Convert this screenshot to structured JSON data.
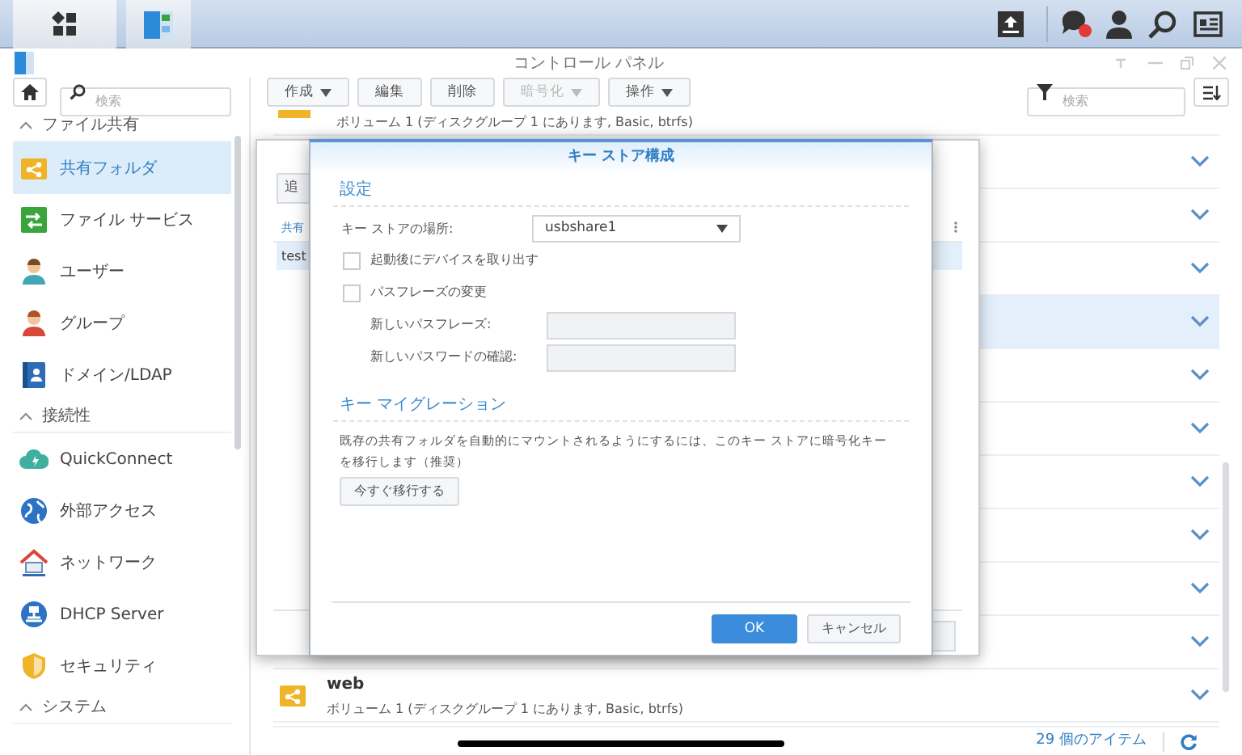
{
  "window": {
    "title": "コントロール パネル"
  },
  "sidebar": {
    "search": {
      "placeholder": "検索"
    },
    "groups": [
      {
        "label": "ファイル共有",
        "expanded": true,
        "items": [
          {
            "label": "共有フォルダ",
            "kind": "share-folder",
            "selected": true
          },
          {
            "label": "ファイル サービス",
            "kind": "file-services",
            "selected": false
          },
          {
            "label": "ユーザー",
            "kind": "user",
            "selected": false
          },
          {
            "label": "グループ",
            "kind": "group",
            "selected": false
          },
          {
            "label": "ドメイン/LDAP",
            "kind": "domain",
            "selected": false
          }
        ]
      },
      {
        "label": "接続性",
        "expanded": true,
        "items": [
          {
            "label": "QuickConnect",
            "kind": "cloud",
            "selected": false
          },
          {
            "label": "外部アクセス",
            "kind": "globe",
            "selected": false
          },
          {
            "label": "ネットワーク",
            "kind": "house",
            "selected": false
          },
          {
            "label": "DHCP Server",
            "kind": "dhcp",
            "selected": false
          },
          {
            "label": "セキュリティ",
            "kind": "shield",
            "selected": false
          }
        ]
      },
      {
        "label": "システム",
        "expanded": true
      }
    ]
  },
  "toolbar": {
    "buttons": [
      {
        "label": "作成",
        "dropdown": true,
        "disabled": false
      },
      {
        "label": "編集",
        "dropdown": false,
        "disabled": false
      },
      {
        "label": "削除",
        "dropdown": false,
        "disabled": false
      },
      {
        "label": "暗号化",
        "dropdown": true,
        "disabled": true
      },
      {
        "label": "操作",
        "dropdown": true,
        "disabled": false
      }
    ],
    "filter": {
      "placeholder": "検索"
    }
  },
  "list": {
    "rows": [
      {
        "subtitle": "ボリューム 1 (ディスクグループ 1 にあります, Basic, btrfs)",
        "selected": false
      },
      {
        "selected": false
      },
      {
        "selected": false
      },
      {
        "selected": false
      },
      {
        "selected": true
      },
      {
        "selected": false
      },
      {
        "selected": false
      },
      {
        "selected": false
      },
      {
        "selected": false
      },
      {
        "selected": false
      },
      {
        "selected": false
      },
      {
        "title": "web",
        "subtitle": "ボリューム 1 (ディスクグループ 1 にあります, Basic, btrfs)",
        "selected": false
      }
    ],
    "count": "29 個のアイテム"
  },
  "back_dialog": {
    "button": "追",
    "column_header": "共有",
    "row": "test"
  },
  "dialog": {
    "title": "キー ストア構成",
    "settings": {
      "heading": "設定",
      "location": {
        "label": "キー ストアの場所:",
        "value": "usbshare1"
      },
      "checkboxes": [
        {
          "label": "起動後にデバイスを取り出す",
          "checked": false
        },
        {
          "label": "パスフレーズの変更",
          "checked": false
        }
      ],
      "fields": [
        {
          "label": "新しいパスフレーズ:",
          "disabled": true
        },
        {
          "label": "新しいパスワードの確認:",
          "disabled": true
        }
      ]
    },
    "migration": {
      "heading": "キー マイグレーション",
      "text": "既存の共有フォルダを自動的にマウントされるようにするには、このキー ストアに暗号化キーを移行します（推奨）",
      "button": "今すぐ移行する"
    },
    "ok": "OK",
    "cancel": "キャンセル"
  }
}
